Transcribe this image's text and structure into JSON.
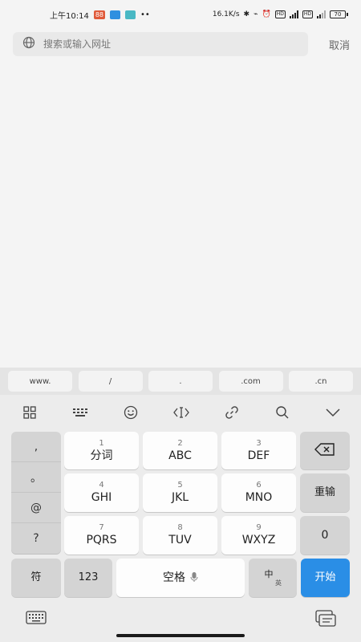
{
  "status": {
    "time": "上午10:14",
    "notify_badge": "88",
    "dots": "••",
    "speed": "16.1K/s",
    "hd1": "HD",
    "net1": "4G",
    "hd2": "HD",
    "net2": "4G",
    "battery": "70"
  },
  "search": {
    "placeholder": "搜索或输入网址",
    "cancel": "取消"
  },
  "url_shortcuts": [
    "www.",
    "/",
    ".",
    ".com",
    ".cn"
  ],
  "keyboard": {
    "symbols": [
      ",",
      "。",
      "@",
      "?",
      "!"
    ],
    "rows": [
      [
        {
          "num": "1",
          "label": "分词"
        },
        {
          "num": "2",
          "label": "ABC"
        },
        {
          "num": "3",
          "label": "DEF"
        }
      ],
      [
        {
          "num": "4",
          "label": "GHI"
        },
        {
          "num": "5",
          "label": "JKL"
        },
        {
          "num": "6",
          "label": "MNO"
        }
      ],
      [
        {
          "num": "7",
          "label": "PQRS"
        },
        {
          "num": "8",
          "label": "TUV"
        },
        {
          "num": "9",
          "label": "WXYZ"
        }
      ]
    ],
    "delete_icon": "backspace-icon",
    "reenter": "重输",
    "zero": "0",
    "wait": "符",
    "num_mode": "123",
    "space": "空格",
    "lang_top": "中",
    "lang_bottom": "英",
    "go": "开始"
  },
  "colors": {
    "accent": "#2a8ee6",
    "background": "#f4f4f4"
  }
}
